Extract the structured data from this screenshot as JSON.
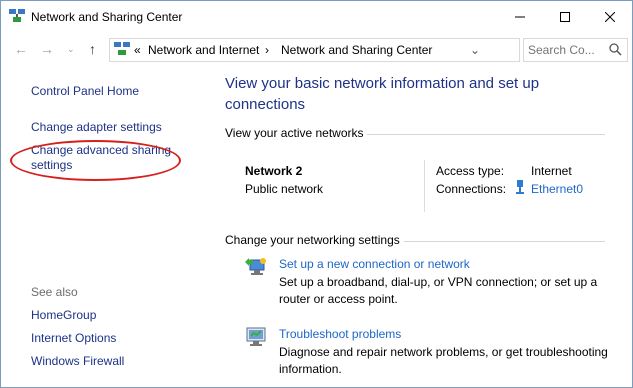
{
  "window": {
    "title": "Network and Sharing Center"
  },
  "address": {
    "overflow": "«",
    "crumbs": [
      "Network and Internet",
      "Network and Sharing Center"
    ],
    "search_placeholder": "Search Co..."
  },
  "left": {
    "links": [
      "Control Panel Home",
      "Change adapter settings",
      "Change advanced sharing settings"
    ],
    "see_also": "See also",
    "see_also_links": [
      "HomeGroup",
      "Internet Options",
      "Windows Firewall"
    ]
  },
  "main": {
    "heading": "View your basic network information and set up connections",
    "active_title": "View your active networks",
    "network": {
      "name": "Network  2",
      "type": "Public network",
      "access_label": "Access type:",
      "access_value": "Internet",
      "conn_label": "Connections:",
      "conn_value": "Ethernet0"
    },
    "change_title": "Change your networking settings",
    "tasks": [
      {
        "title": "Set up a new connection or network",
        "desc": "Set up a broadband, dial-up, or VPN connection; or set up a router or access point.",
        "icon": "new-connection-icon"
      },
      {
        "title": "Troubleshoot problems",
        "desc": "Diagnose and repair network problems, or get troubleshooting information.",
        "icon": "troubleshoot-icon"
      }
    ]
  },
  "colors": {
    "link": "#1e66c8",
    "nav_link": "#1e3287",
    "highlight": "#d5201d"
  }
}
